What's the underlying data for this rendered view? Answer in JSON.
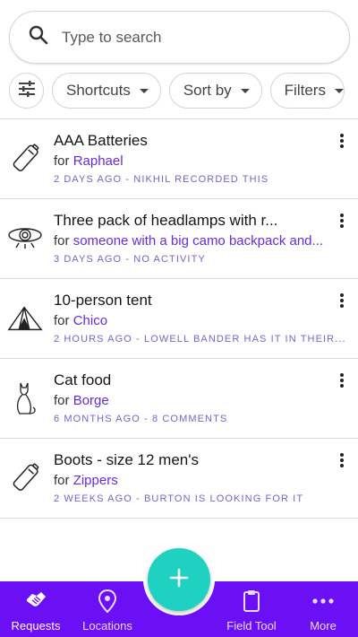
{
  "search": {
    "placeholder": "Type to search",
    "icon": "search-icon"
  },
  "filters": {
    "settings_icon": "tune-icon",
    "chips": [
      {
        "label": "Shortcuts"
      },
      {
        "label": "Sort by"
      },
      {
        "label": "Filters"
      }
    ]
  },
  "requests": [
    {
      "title": "AAA Batteries",
      "for_prefix": "for",
      "recipient": "Raphael",
      "meta": "2 DAYS AGO - NIKHIL RECORDED THIS",
      "icon": "battery-icon"
    },
    {
      "title": "Three pack of headlamps with r...",
      "for_prefix": "for",
      "recipient": "someone with a big camo backpack and...",
      "meta": "3 DAYS AGO - NO ACTIVITY",
      "icon": "headlamp-icon"
    },
    {
      "title": "10-person tent",
      "for_prefix": "for",
      "recipient": "Chico",
      "meta": "2 HOURS AGO - LOWELL BANDER HAS IT IN THEIR...",
      "icon": "tent-icon"
    },
    {
      "title": "Cat food",
      "for_prefix": "for",
      "recipient": "Borge",
      "meta": "6 MONTHS AGO - 8 COMMENTS",
      "icon": "cat-icon"
    },
    {
      "title": "Boots - size 12 men's",
      "for_prefix": "for",
      "recipient": "Zippers",
      "meta": "2 WEEKS AGO - BURTON IS LOOKING FOR IT",
      "icon": "battery-icon"
    }
  ],
  "fab": {
    "icon": "plus-icon",
    "color": "#1fd1c0"
  },
  "nav": {
    "color": "#6b10f5",
    "items": [
      {
        "label": "Requests",
        "icon": "handshake-icon",
        "active": true
      },
      {
        "label": "Locations",
        "icon": "location-pin-icon",
        "active": false
      },
      {
        "label": "Field Tool",
        "icon": "clipboard-icon",
        "active": false
      },
      {
        "label": "More",
        "icon": "more-dots-icon",
        "active": false
      }
    ]
  },
  "colors": {
    "accent": "#6a2bd9",
    "meta": "#7b61c9"
  }
}
